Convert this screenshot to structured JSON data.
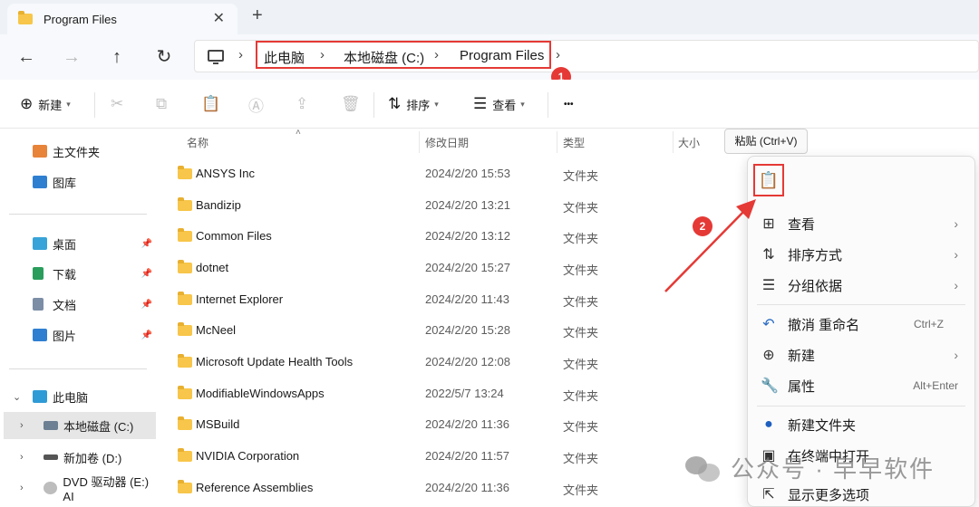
{
  "window": {
    "tab_title": "Program Files",
    "close_glyph": "✕",
    "new_tab_glyph": "+"
  },
  "nav": {
    "back": "←",
    "forward": "→",
    "up": "↑",
    "refresh": "↻",
    "crumb_sep": "›",
    "breadcrumbs": [
      "此电脑",
      "本地磁盘 (C:)",
      "Program Files"
    ]
  },
  "toolbar": {
    "new_label": "新建",
    "sort_label": "排序",
    "view_label": "查看",
    "more_glyph": "•••"
  },
  "sidebar": {
    "home": "主文件夹",
    "gallery": "图库",
    "desktop": "桌面",
    "downloads": "下载",
    "documents": "文档",
    "pictures": "图片",
    "this_pc": "此电脑",
    "drive_c": "本地磁盘 (C:)",
    "drive_d": "新加卷 (D:)",
    "drive_e": "DVD 驱动器 (E:) AI"
  },
  "columns": {
    "name": "名称",
    "modified": "修改日期",
    "type": "类型",
    "size": "大小"
  },
  "files": [
    {
      "name": "ANSYS Inc",
      "date": "2024/2/20 15:53",
      "type": "文件夹"
    },
    {
      "name": "Bandizip",
      "date": "2024/2/20 13:21",
      "type": "文件夹"
    },
    {
      "name": "Common Files",
      "date": "2024/2/20 13:12",
      "type": "文件夹"
    },
    {
      "name": "dotnet",
      "date": "2024/2/20 15:27",
      "type": "文件夹"
    },
    {
      "name": "Internet Explorer",
      "date": "2024/2/20 11:43",
      "type": "文件夹"
    },
    {
      "name": "McNeel",
      "date": "2024/2/20 15:28",
      "type": "文件夹"
    },
    {
      "name": "Microsoft Update Health Tools",
      "date": "2024/2/20 12:08",
      "type": "文件夹"
    },
    {
      "name": "ModifiableWindowsApps",
      "date": "2022/5/7 13:24",
      "type": "文件夹"
    },
    {
      "name": "MSBuild",
      "date": "2024/2/20 11:36",
      "type": "文件夹"
    },
    {
      "name": "NVIDIA Corporation",
      "date": "2024/2/20 11:57",
      "type": "文件夹"
    },
    {
      "name": "Reference Assemblies",
      "date": "2024/2/20 11:36",
      "type": "文件夹"
    }
  ],
  "tooltip": "粘贴 (Ctrl+V)",
  "context_menu": {
    "view": "查看",
    "sort_by": "排序方式",
    "group_by": "分组依据",
    "undo_rename": "撤消 重命名",
    "undo_shortcut": "Ctrl+Z",
    "new": "新建",
    "properties": "属性",
    "properties_shortcut": "Alt+Enter",
    "new_folder": "新建文件夹",
    "open_terminal": "在终端中打开",
    "show_more": "显示更多选项"
  },
  "annotations": {
    "badge_1": "1",
    "badge_2": "2",
    "accent_red": "#e53935"
  },
  "watermark": "公众号 · 早早软件"
}
